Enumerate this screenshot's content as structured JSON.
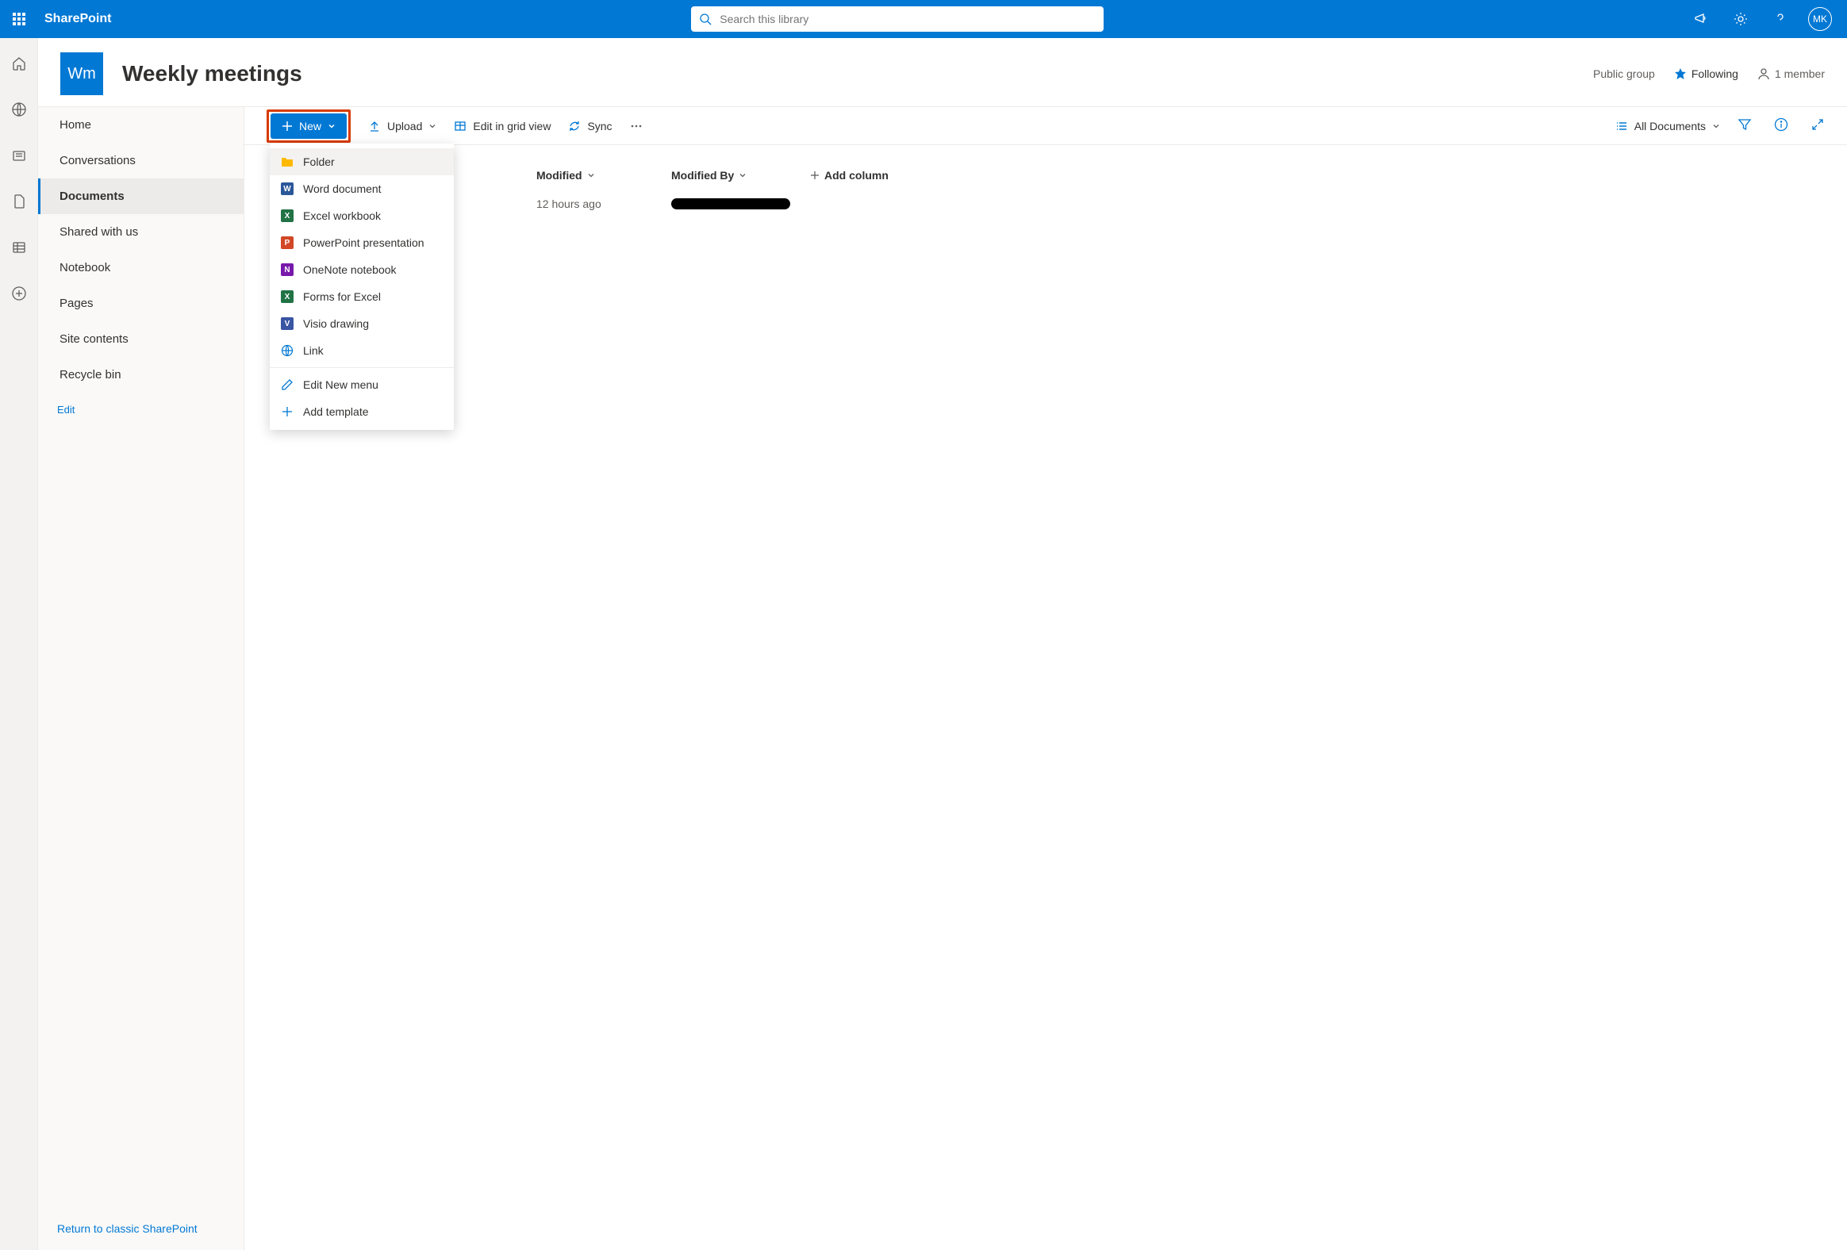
{
  "suite": {
    "app_name": "SharePoint",
    "search_placeholder": "Search this library",
    "avatar_initials": "MK"
  },
  "site": {
    "logo_text": "Wm",
    "title": "Weekly meetings",
    "visibility": "Public group",
    "follow_label": "Following",
    "members_label": "1 member"
  },
  "nav": {
    "items": [
      "Home",
      "Conversations",
      "Documents",
      "Shared with us",
      "Notebook",
      "Pages",
      "Site contents",
      "Recycle bin"
    ],
    "active_index": 2,
    "edit_label": "Edit",
    "return_label": "Return to classic SharePoint"
  },
  "commands": {
    "new_label": "New",
    "upload_label": "Upload",
    "grid_label": "Edit in grid view",
    "sync_label": "Sync",
    "view_label": "All Documents"
  },
  "new_menu": {
    "items": [
      {
        "label": "Folder",
        "color": "#ffb900",
        "letter": ""
      },
      {
        "label": "Word document",
        "color": "#2b579a",
        "letter": "W"
      },
      {
        "label": "Excel workbook",
        "color": "#217346",
        "letter": "X"
      },
      {
        "label": "PowerPoint presentation",
        "color": "#d24726",
        "letter": "P"
      },
      {
        "label": "OneNote notebook",
        "color": "#7719aa",
        "letter": "N"
      },
      {
        "label": "Forms for Excel",
        "color": "#217346",
        "letter": "X"
      },
      {
        "label": "Visio drawing",
        "color": "#3955a3",
        "letter": "V"
      },
      {
        "label": "Link",
        "color": "",
        "letter": ""
      }
    ],
    "edit_menu": "Edit New menu",
    "add_template": "Add template"
  },
  "table": {
    "columns": {
      "modified": "Modified",
      "modified_by": "Modified By",
      "add": "Add column"
    },
    "rows": [
      {
        "modified": "12 hours ago"
      }
    ]
  }
}
